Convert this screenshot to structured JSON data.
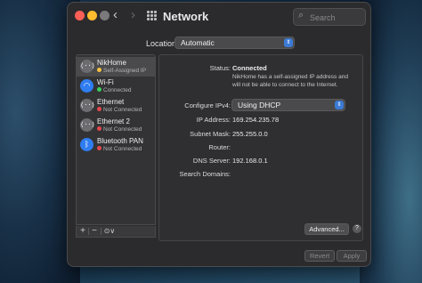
{
  "window": {
    "title": "Network"
  },
  "search": {
    "placeholder": "Search"
  },
  "location": {
    "label": "Location:",
    "value": "Automatic"
  },
  "services": [
    {
      "name": "NikHome",
      "status": "Self-Assigned IP",
      "status_color": "#f6c343",
      "icon": "ethernet-icon"
    },
    {
      "name": "Wi-Fi",
      "status": "Connected",
      "status_color": "#3ccf5a",
      "icon": "wifi-icon"
    },
    {
      "name": "Ethernet",
      "status": "Not Connected",
      "status_color": "#e5484d",
      "icon": "ethernet-icon"
    },
    {
      "name": "Ethernet 2",
      "status": "Not Connected",
      "status_color": "#e5484d",
      "icon": "ethernet-icon"
    },
    {
      "name": "Bluetooth PAN",
      "status": "Not Connected",
      "status_color": "#e5484d",
      "icon": "bluetooth-icon"
    }
  ],
  "toolbar": {
    "add": "+",
    "remove": "−",
    "action": "⊙∨"
  },
  "detail": {
    "status_label": "Status:",
    "status_value": "Connected",
    "status_desc": "NikHome has a self-assigned IP address and will not be able to connect to the Internet.",
    "configure_label": "Configure IPv4:",
    "configure_value": "Using DHCP",
    "ip_label": "IP Address:",
    "ip_value": "169.254.235.78",
    "subnet_label": "Subnet Mask:",
    "subnet_value": "255.255.0.0",
    "router_label": "Router:",
    "router_value": "",
    "dns_label": "DNS Server:",
    "dns_value": "192.168.0.1",
    "search_domains_label": "Search Domains:",
    "search_domains_value": ""
  },
  "buttons": {
    "advanced": "Advanced...",
    "help": "?",
    "revert": "Revert",
    "apply": "Apply"
  },
  "colors": {
    "accent": "#3c7bd6",
    "window_bg": "#2b2b2d"
  }
}
